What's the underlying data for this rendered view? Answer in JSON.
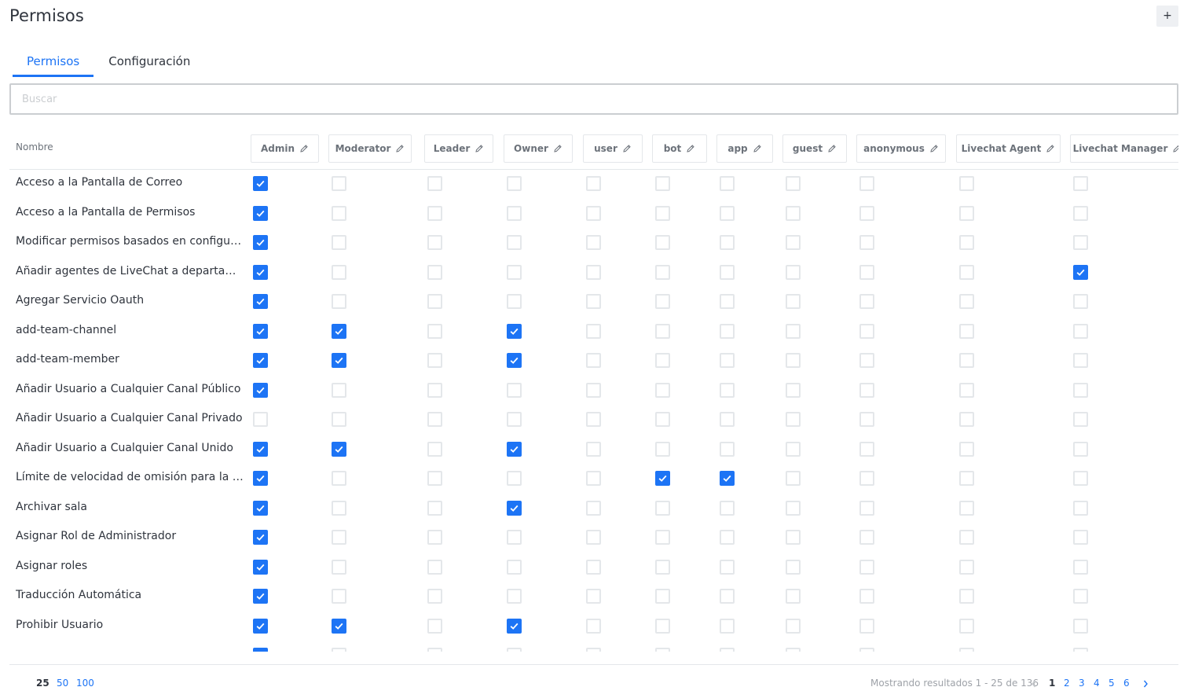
{
  "header": {
    "title": "Permisos",
    "add_label": "+"
  },
  "tabs": [
    {
      "label": "Permisos",
      "active": true
    },
    {
      "label": "Configuración",
      "active": false
    }
  ],
  "search": {
    "placeholder": "Buscar",
    "value": ""
  },
  "table": {
    "name_header": "Nombre",
    "roles": [
      "Admin",
      "Moderator",
      "Leader",
      "Owner",
      "user",
      "bot",
      "app",
      "guest",
      "anonymous",
      "Livechat Agent",
      "Livechat Manager"
    ],
    "rows": [
      {
        "name": "Acceso a la Pantalla de Correo",
        "checks": [
          1,
          0,
          0,
          0,
          0,
          0,
          0,
          0,
          0,
          0,
          0
        ]
      },
      {
        "name": "Acceso a la Pantalla de Permisos",
        "checks": [
          1,
          0,
          0,
          0,
          0,
          0,
          0,
          0,
          0,
          0,
          0
        ]
      },
      {
        "name": "Modificar permisos basados en configuración",
        "checks": [
          1,
          0,
          0,
          0,
          0,
          0,
          0,
          0,
          0,
          0,
          0
        ]
      },
      {
        "name": "Añadir agentes de LiveChat a departamentos",
        "checks": [
          1,
          0,
          0,
          0,
          0,
          0,
          0,
          0,
          0,
          0,
          1
        ]
      },
      {
        "name": "Agregar Servicio Oauth",
        "checks": [
          1,
          0,
          0,
          0,
          0,
          0,
          0,
          0,
          0,
          0,
          0
        ]
      },
      {
        "name": "add-team-channel",
        "checks": [
          1,
          1,
          0,
          1,
          0,
          0,
          0,
          0,
          0,
          0,
          0
        ]
      },
      {
        "name": "add-team-member",
        "checks": [
          1,
          1,
          0,
          1,
          0,
          0,
          0,
          0,
          0,
          0,
          0
        ]
      },
      {
        "name": "Añadir Usuario a Cualquier Canal Público",
        "checks": [
          1,
          0,
          0,
          0,
          0,
          0,
          0,
          0,
          0,
          0,
          0
        ]
      },
      {
        "name": "Añadir Usuario a Cualquier Canal Privado",
        "checks": [
          0,
          0,
          0,
          0,
          0,
          0,
          0,
          0,
          0,
          0,
          0
        ]
      },
      {
        "name": "Añadir Usuario a Cualquier Canal Unido",
        "checks": [
          1,
          1,
          0,
          1,
          0,
          0,
          0,
          0,
          0,
          0,
          0
        ]
      },
      {
        "name": "Límite de velocidad de omisión para la API R...",
        "checks": [
          1,
          0,
          0,
          0,
          0,
          1,
          1,
          0,
          0,
          0,
          0
        ]
      },
      {
        "name": "Archivar sala",
        "checks": [
          1,
          0,
          0,
          1,
          0,
          0,
          0,
          0,
          0,
          0,
          0
        ]
      },
      {
        "name": "Asignar Rol de Administrador",
        "checks": [
          1,
          0,
          0,
          0,
          0,
          0,
          0,
          0,
          0,
          0,
          0
        ]
      },
      {
        "name": "Asignar roles",
        "checks": [
          1,
          0,
          0,
          0,
          0,
          0,
          0,
          0,
          0,
          0,
          0
        ]
      },
      {
        "name": "Traducción Automática",
        "checks": [
          1,
          0,
          0,
          0,
          0,
          0,
          0,
          0,
          0,
          0,
          0
        ]
      },
      {
        "name": "Prohibir Usuario",
        "checks": [
          1,
          1,
          0,
          1,
          0,
          0,
          0,
          0,
          0,
          0,
          0
        ]
      },
      {
        "name": "",
        "checks": [
          1,
          0,
          0,
          0,
          0,
          0,
          0,
          0,
          0,
          0,
          0
        ]
      }
    ]
  },
  "footer": {
    "page_sizes": [
      "25",
      "50",
      "100"
    ],
    "current_page_size": "25",
    "results_text": "Mostrando resultados 1 - 25 de 136",
    "pages": [
      "1",
      "2",
      "3",
      "4",
      "5",
      "6"
    ],
    "current_page": "1"
  },
  "colors": {
    "accent": "#1d74f5",
    "border": "#e4e7ea",
    "text": "#2f343d",
    "muted": "#9ea2a8"
  }
}
